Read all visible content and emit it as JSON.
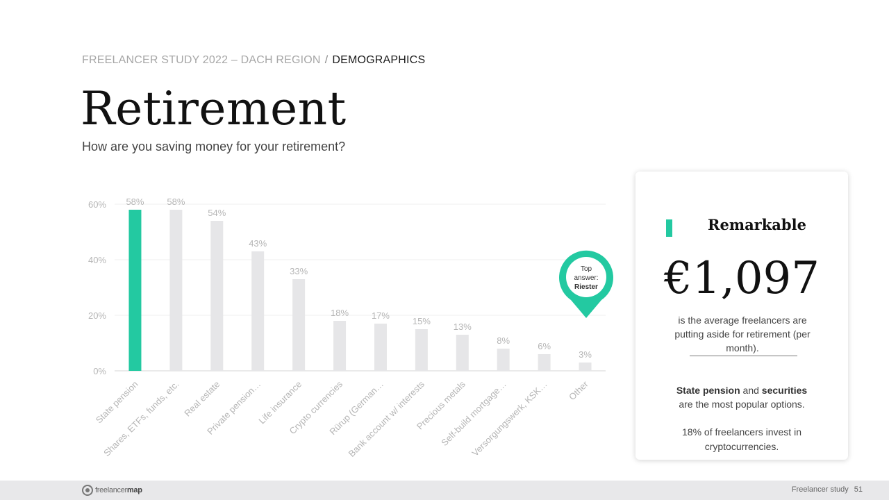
{
  "breadcrumb": {
    "section": "FREELANCER STUDY 2022 – DACH REGION",
    "separator": "/",
    "current": "DEMOGRAPHICS"
  },
  "title": "Retirement",
  "subtitle": "How are you saving money for your retirement?",
  "colors": {
    "accent": "#23c9a1",
    "bar": "#e6e6e8",
    "label": "#b5b5b5"
  },
  "chart_data": {
    "type": "bar",
    "categories": [
      "State pension",
      "Shares, ETFs, funds, etc.",
      "Real estate",
      "Private pension…",
      "Life insurance",
      "Crypto currencies",
      "Rürup (German…",
      "Bank account w/ interests",
      "Precious metals",
      "Self-build mortgage…",
      "Versorgungswerk, KSK…",
      "Other"
    ],
    "values": [
      58,
      58,
      54,
      43,
      33,
      18,
      17,
      15,
      13,
      8,
      6,
      3
    ],
    "data_labels": [
      "58%",
      "58%",
      "54%",
      "43%",
      "33%",
      "18%",
      "17%",
      "15%",
      "13%",
      "8%",
      "6%",
      "3%"
    ],
    "ylim": [
      0,
      60
    ],
    "yticks": [
      0,
      20,
      40,
      60
    ],
    "ytick_labels": [
      "0%",
      "20%",
      "40%",
      "60%"
    ],
    "highlight_index": 0,
    "grid": true,
    "annotation": {
      "line1": "Top",
      "line2": "answer:",
      "line3": "Riester"
    }
  },
  "card": {
    "heading": "Remarkable",
    "big_value": "€1,097",
    "description": "is the average freelancers are putting aside for retirement (per month).",
    "note1_bold1": "State pension",
    "note1_and": " and ",
    "note1_bold2": "securities",
    "note1_rest": "are the most popular options.",
    "note2": "18% of freelancers invest in cryptocurrencies."
  },
  "footer": {
    "logo_light": "freelancer",
    "logo_bold": "map",
    "right_text": "Freelancer study",
    "page": "51"
  }
}
